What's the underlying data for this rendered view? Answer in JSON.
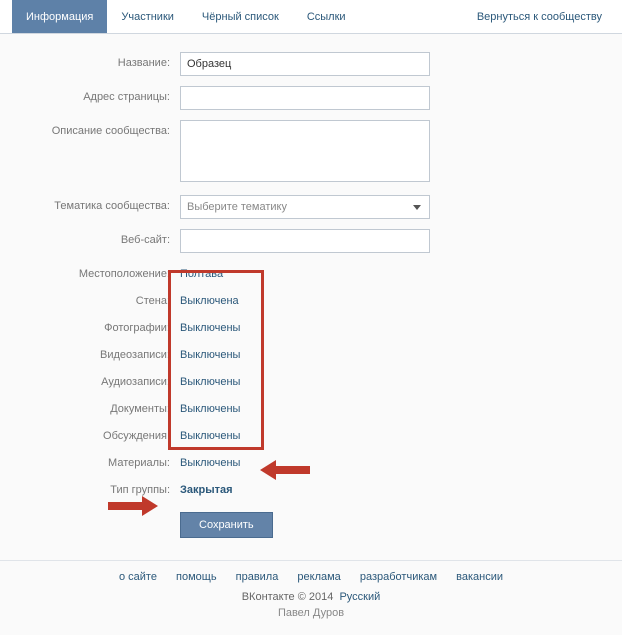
{
  "tabs": {
    "info": "Информация",
    "members": "Участники",
    "blacklist": "Чёрный список",
    "links": "Ссылки",
    "back": "Вернуться к сообществу"
  },
  "labels": {
    "name": "Название:",
    "address": "Адрес страницы:",
    "description": "Описание сообщества:",
    "topic": "Тематика сообщества:",
    "website": "Веб-сайт:",
    "location": "Местоположение:",
    "wall": "Стена:",
    "photos": "Фотографии:",
    "videos": "Видеозаписи:",
    "audios": "Аудиозаписи:",
    "docs": "Документы:",
    "discussions": "Обсуждения:",
    "materials": "Материалы:",
    "grouptype": "Тип группы:"
  },
  "values": {
    "name": "Образец",
    "address": "",
    "description": "",
    "topic_placeholder": "Выберите тематику",
    "website": "",
    "location": "Полтава",
    "wall": "Выключена",
    "photos": "Выключены",
    "videos": "Выключены",
    "audios": "Выключены",
    "docs": "Выключены",
    "discussions": "Выключены",
    "materials": "Выключены",
    "grouptype": "Закрытая"
  },
  "save": "Сохранить",
  "footer": {
    "about": "о сайте",
    "help": "помощь",
    "rules": "правила",
    "ads": "реклама",
    "devs": "разработчикам",
    "jobs": "вакансии",
    "copyright": "ВКонтакте © 2014",
    "lang": "Русский",
    "author": "Павел Дуров"
  }
}
